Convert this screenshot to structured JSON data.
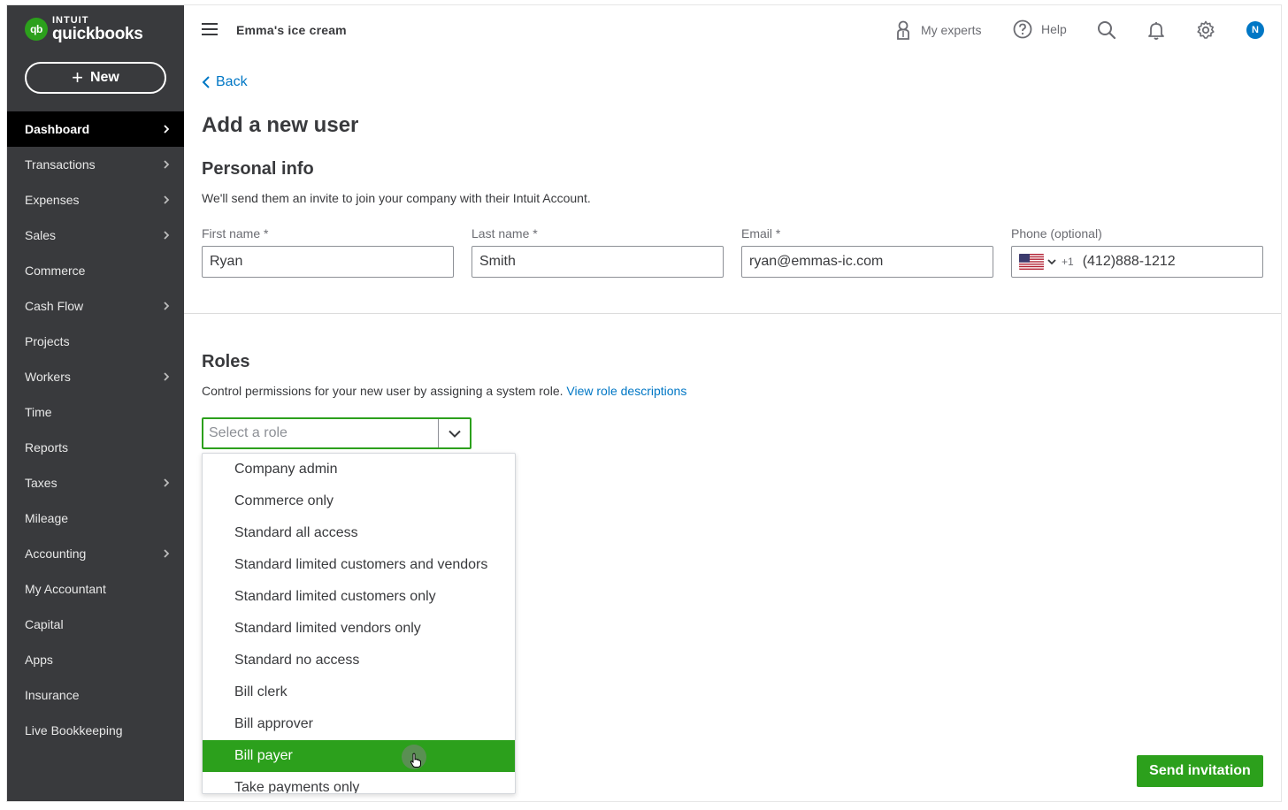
{
  "sidebar": {
    "logo": {
      "mark": "qb",
      "brand_top": "INTUIT",
      "brand": "quickbooks"
    },
    "new_label": "New",
    "items": [
      {
        "label": "Dashboard",
        "chevron": true,
        "active": true
      },
      {
        "label": "Transactions",
        "chevron": true
      },
      {
        "label": "Expenses",
        "chevron": true
      },
      {
        "label": "Sales",
        "chevron": true
      },
      {
        "label": "Commerce",
        "chevron": false
      },
      {
        "label": "Cash Flow",
        "chevron": true
      },
      {
        "label": "Projects",
        "chevron": false
      },
      {
        "label": "Workers",
        "chevron": true
      },
      {
        "label": "Time",
        "chevron": false
      },
      {
        "label": "Reports",
        "chevron": false
      },
      {
        "label": "Taxes",
        "chevron": true
      },
      {
        "label": "Mileage",
        "chevron": false
      },
      {
        "label": "Accounting",
        "chevron": true
      },
      {
        "label": "My Accountant",
        "chevron": false
      },
      {
        "label": "Capital",
        "chevron": false
      },
      {
        "label": "Apps",
        "chevron": false
      },
      {
        "label": "Insurance",
        "chevron": false
      },
      {
        "label": "Live Bookkeeping",
        "chevron": false
      }
    ]
  },
  "header": {
    "company": "Emma's ice cream",
    "my_experts": "My experts",
    "help": "Help",
    "avatar_initial": "N",
    "icons": [
      "menu-icon",
      "experts-icon",
      "help-icon",
      "search-icon",
      "bell-icon",
      "gear-icon"
    ]
  },
  "main": {
    "back_label": "Back",
    "title": "Add a new user",
    "personal": {
      "heading": "Personal info",
      "description": "We'll send them an invite to join your company with their Intuit Account.",
      "first_name": {
        "label": "First name *",
        "value": "Ryan"
      },
      "last_name": {
        "label": "Last name *",
        "value": "Smith"
      },
      "email": {
        "label": "Email *",
        "value": "ryan@emmas-ic.com"
      },
      "phone": {
        "label": "Phone (optional)",
        "country_code": "+1",
        "value": "(412)888-1212"
      }
    },
    "roles": {
      "heading": "Roles",
      "description": "Control permissions for your new user by assigning a system role.",
      "link": "View role descriptions",
      "select_placeholder": "Select a role",
      "options": [
        "Company admin",
        "Commerce only",
        "Standard all access",
        "Standard limited customers and vendors",
        "Standard limited customers only",
        "Standard limited vendors only",
        "Standard no access",
        "Bill clerk",
        "Bill approver",
        "Bill payer",
        "Take payments only"
      ],
      "highlighted_option": "Bill payer"
    },
    "send_label": "Send invitation"
  },
  "colors": {
    "sidebar_bg": "#393a3d",
    "sidebar_active": "#000000",
    "brand_green": "#2ca01c",
    "link_blue": "#0077c5"
  }
}
